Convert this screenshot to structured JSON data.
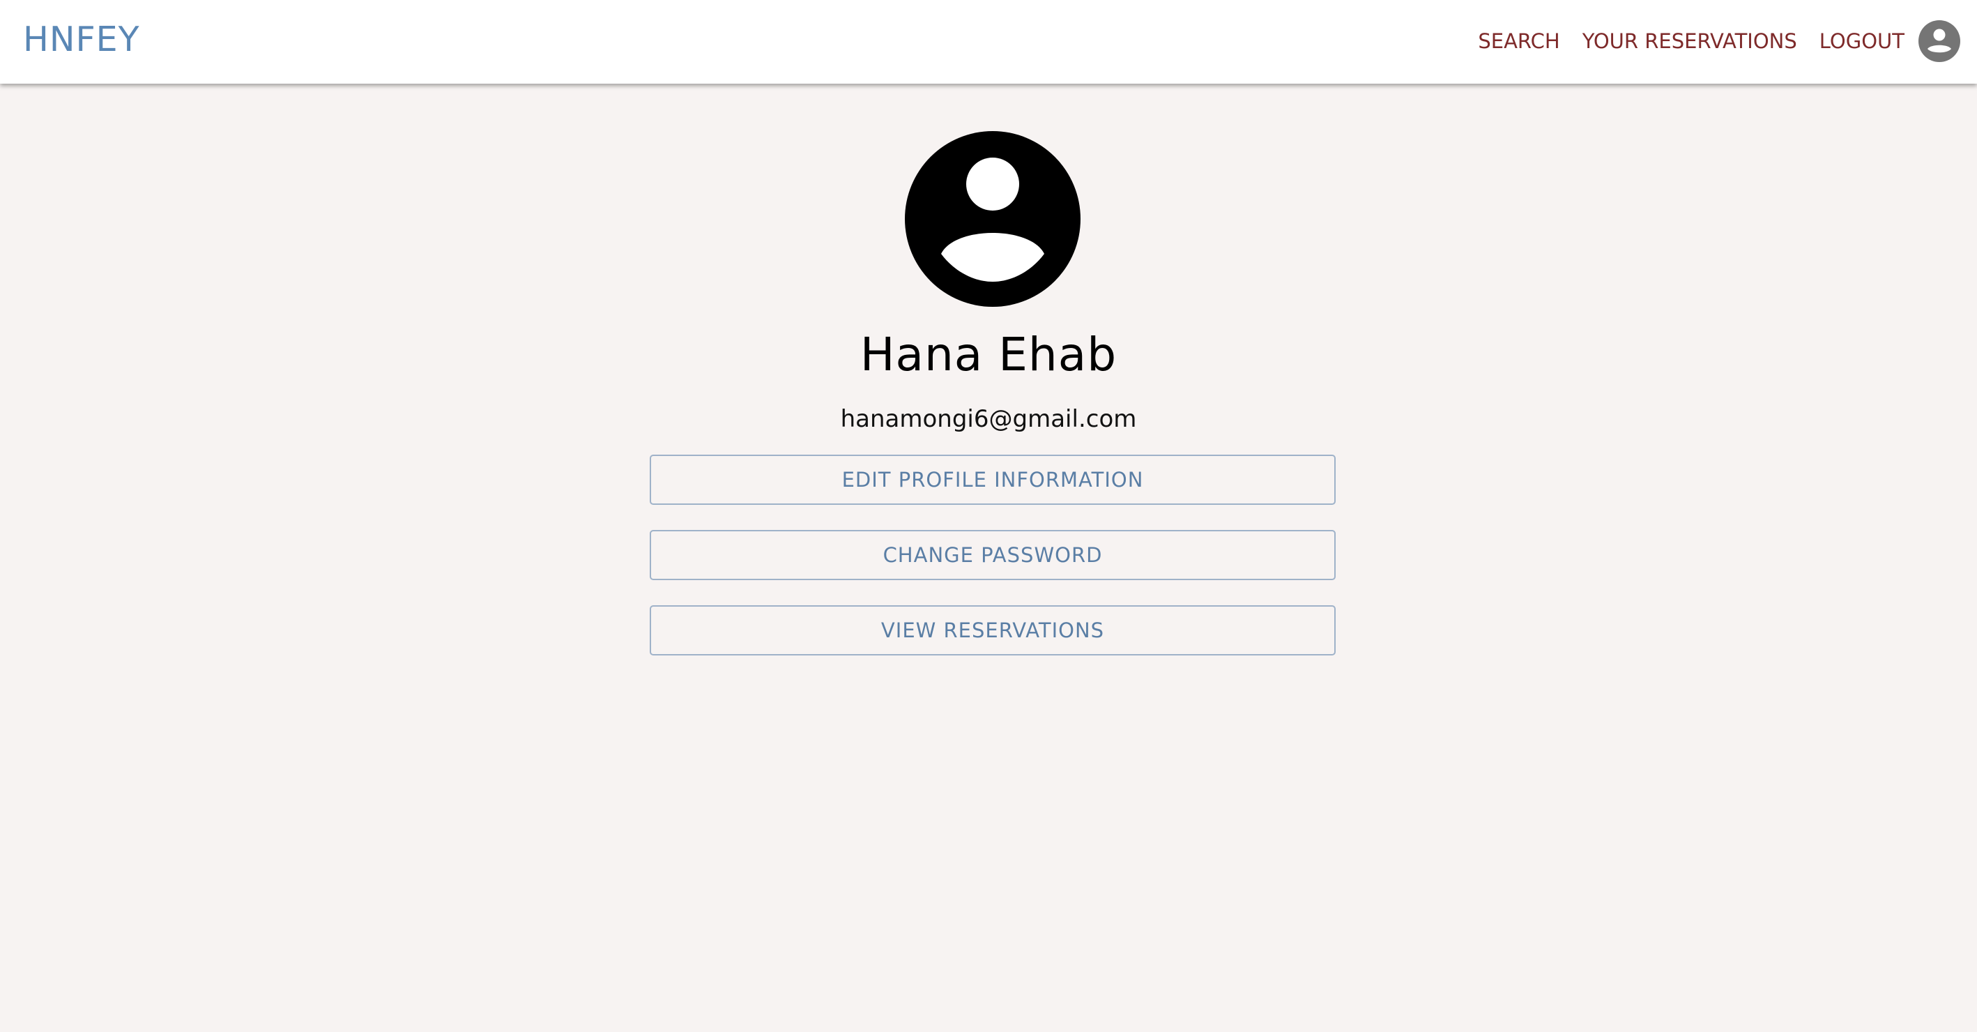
{
  "navbar": {
    "brand": "HNFEY",
    "links": [
      {
        "label": "SEARCH"
      },
      {
        "label": "YOUR RESERVATIONS"
      },
      {
        "label": "LOGOUT"
      }
    ],
    "avatar_icon": "account-circle-icon",
    "brand_color": "#5a87b5",
    "link_color": "#7e2a2a"
  },
  "profile": {
    "avatar_icon": "account-circle-icon",
    "name": "Hana Ehab",
    "email": "hanamongi6@gmail.com",
    "actions": [
      {
        "label": "EDIT PROFILE INFORMATION"
      },
      {
        "label": "CHANGE PASSWORD"
      },
      {
        "label": "VIEW RESERVATIONS"
      }
    ],
    "button_text_color": "#5a7ea5",
    "background_color": "#f7f3f2"
  }
}
